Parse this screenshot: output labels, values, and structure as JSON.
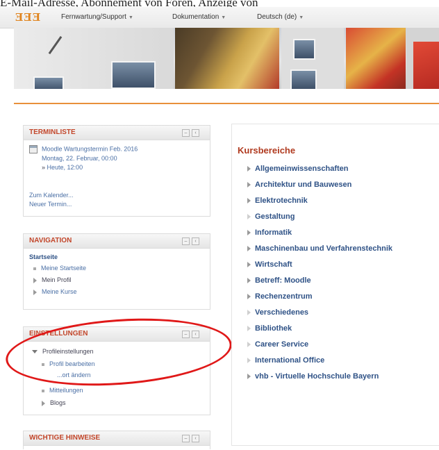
{
  "caption": "E-Mail-Adresse, Abonnement von Foren, Anzeige von",
  "header": {
    "logo": "ƎƎƎ",
    "menu": [
      {
        "label": "Fernwartung/Support"
      },
      {
        "label": "Dokumentation"
      },
      {
        "label": "Deutsch (de)"
      }
    ]
  },
  "blocks": {
    "terminliste": {
      "title": "TERMINLISTE",
      "event_title": "Moodle Wartungstermin Feb. 2016",
      "event_date": "Montag, 22. Februar, 00:00",
      "event_time_prefix": "»",
      "event_time": "Heute, 12:00",
      "calendar_link": "Zum Kalender...",
      "new_event_link": "Neuer Termin..."
    },
    "navigation": {
      "title": "NAVIGATION",
      "home": "Startseite",
      "items": [
        "Meine Startseite",
        "Mein Profil",
        "Meine Kurse"
      ]
    },
    "einstellungen": {
      "title": "EINSTELLUNGEN",
      "profile_settings": "Profileinstellungen",
      "items": [
        "Profil bearbeiten",
        "...ort ändern",
        "Mitteilungen",
        "Blogs"
      ]
    },
    "hinweise": {
      "title": "WICHTIGE HINWEISE"
    }
  },
  "main": {
    "heading": "Kursbereiche",
    "categories": [
      {
        "label": "Allgemeinwissenschaften",
        "filled": true
      },
      {
        "label": "Architektur und Bauwesen",
        "filled": true
      },
      {
        "label": "Elektrotechnik",
        "filled": true
      },
      {
        "label": "Gestaltung",
        "filled": false
      },
      {
        "label": "Informatik",
        "filled": true
      },
      {
        "label": "Maschinenbau und Verfahrenstechnik",
        "filled": true
      },
      {
        "label": "Wirtschaft",
        "filled": true
      },
      {
        "label": "Betreff: Moodle",
        "filled": true
      },
      {
        "label": "Rechenzentrum",
        "filled": true
      },
      {
        "label": "Verschiedenes",
        "filled": false
      },
      {
        "label": "Bibliothek",
        "filled": false
      },
      {
        "label": "Career Service",
        "filled": false
      },
      {
        "label": "International Office",
        "filled": false
      },
      {
        "label": "vhb - Virtuelle Hochschule Bayern",
        "filled": true
      }
    ]
  },
  "colors": {
    "accent": "#e8903a",
    "block_title": "#c2462a",
    "category_link": "#2f5286",
    "annotation": "#e01818"
  }
}
